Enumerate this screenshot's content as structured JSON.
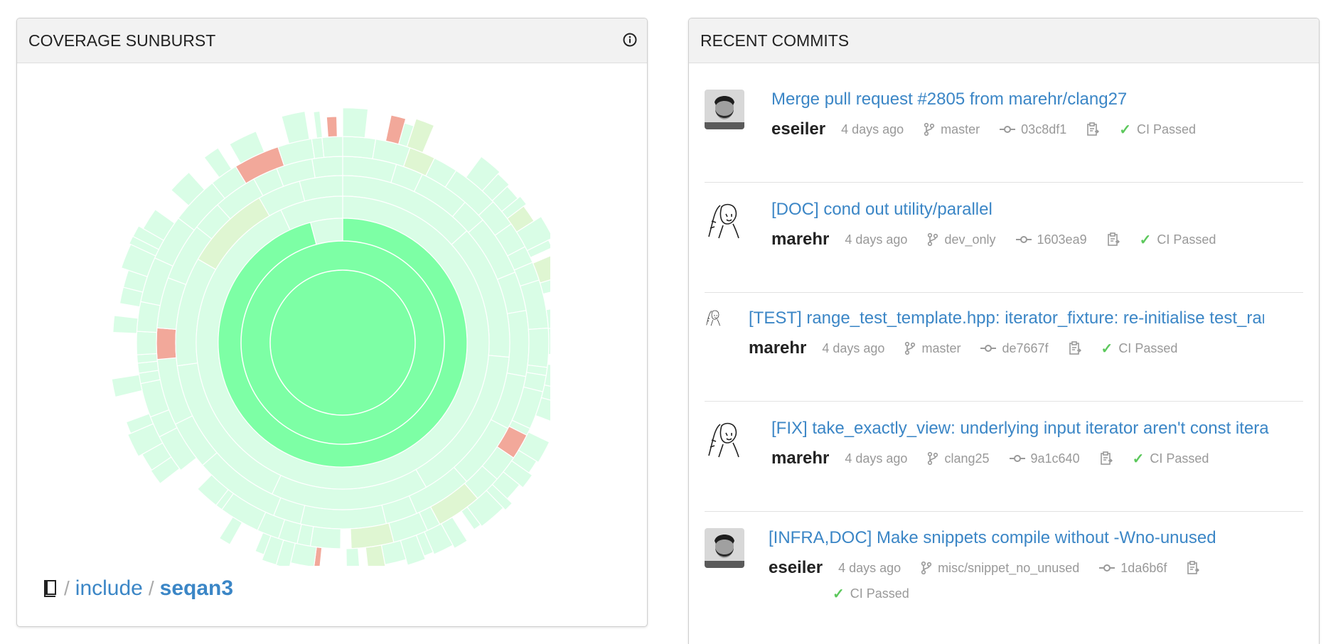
{
  "sunburst_panel": {
    "title": "COVERAGE SUNBURST",
    "breadcrumb": {
      "parts": [
        "include",
        "seqan3"
      ],
      "separator": "/"
    }
  },
  "commits_panel": {
    "title": "RECENT COMMITS",
    "commits": [
      {
        "title": "Merge pull request #2805 from marehr/clang27",
        "author": "eseiler",
        "time": "4 days ago",
        "branch": "master",
        "sha": "03c8df1",
        "status": "CI Passed",
        "avatar": "photo"
      },
      {
        "title": "[DOC] cond out utility/parallel",
        "author": "marehr",
        "time": "4 days ago",
        "branch": "dev_only",
        "sha": "1603ea9",
        "status": "CI Passed",
        "avatar": "sketch"
      },
      {
        "title": "[TEST] range_test_template.hpp: iterator_fixture: re-initialise test_range c",
        "author": "marehr",
        "time": "4 days ago",
        "branch": "master",
        "sha": "de7667f",
        "status": "CI Passed",
        "avatar": "sketch-small"
      },
      {
        "title": "[FIX] take_exactly_view: underlying input iterator aren't const iterable",
        "author": "marehr",
        "time": "4 days ago",
        "branch": "clang25",
        "sha": "9a1c640",
        "status": "CI Passed",
        "avatar": "sketch"
      },
      {
        "title": "[INFRA,DOC] Make snippets compile without -Wno-unused",
        "author": "eseiler",
        "time": "4 days ago",
        "branch": "misc/snippet_no_unused",
        "sha": "1da6b6f",
        "status": "CI Passed",
        "avatar": "photo"
      }
    ]
  },
  "colors": {
    "covered_high": "#7dffa5",
    "covered_light": "#d9fde6",
    "partial": "#dff6d2",
    "uncovered": "#f2a89a",
    "link": "#3b86c6",
    "ci_ok": "#5cc85c"
  },
  "icons": [
    "info-icon",
    "book-icon",
    "branch-icon",
    "commit-icon",
    "copy-icon",
    "check-icon"
  ]
}
